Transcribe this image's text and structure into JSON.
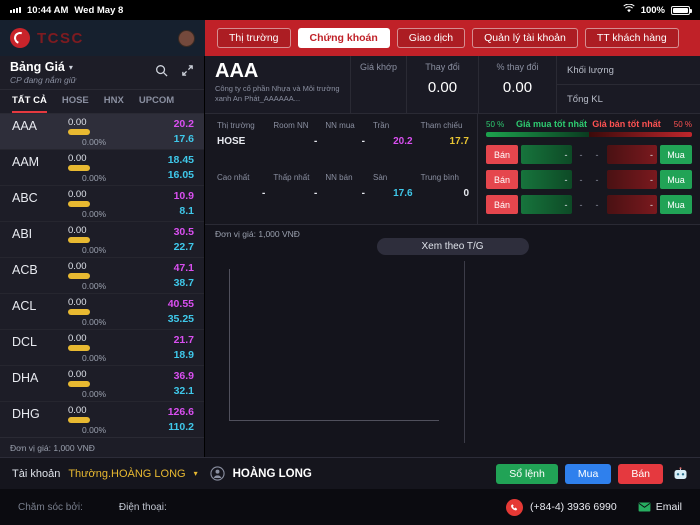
{
  "status_bar": {
    "time": "10:44 AM",
    "date": "Wed May 8",
    "battery": "100%"
  },
  "header": {
    "brand": "TCSC",
    "tabs": [
      {
        "label": "Thị trường"
      },
      {
        "label": "Chứng khoán"
      },
      {
        "label": "Giao dịch"
      },
      {
        "label": "Quản lý tài khoản"
      },
      {
        "label": "TT khách hàng"
      }
    ]
  },
  "sidebar": {
    "title": "Bảng Giá",
    "subtitle": "CP đang nắm giữ",
    "tabs": [
      "TẤT CẢ",
      "HOSE",
      "HNX",
      "UPCOM"
    ],
    "unit_note": "Đơn vị giá: 1,000 VNĐ",
    "stocks": [
      {
        "symbol": "AAA",
        "value": "0.00",
        "percent": "0.00%",
        "top": "20.2",
        "bottom": "17.6",
        "top_color": "#d94ff0",
        "bottom_color": "#3fc8ea"
      },
      {
        "symbol": "AAM",
        "value": "0.00",
        "percent": "0.00%",
        "top": "18.45",
        "bottom": "16.05",
        "top_color": "#3fc8ea",
        "bottom_color": "#3fc8ea"
      },
      {
        "symbol": "ABC",
        "value": "0.00",
        "percent": "0.00%",
        "top": "10.9",
        "bottom": "8.1",
        "top_color": "#d94ff0",
        "bottom_color": "#3fc8ea"
      },
      {
        "symbol": "ABI",
        "value": "0.00",
        "percent": "0.00%",
        "top": "30.5",
        "bottom": "22.7",
        "top_color": "#d94ff0",
        "bottom_color": "#3fc8ea"
      },
      {
        "symbol": "ACB",
        "value": "0.00",
        "percent": "0.00%",
        "top": "47.1",
        "bottom": "38.7",
        "top_color": "#d94ff0",
        "bottom_color": "#3fc8ea"
      },
      {
        "symbol": "ACL",
        "value": "0.00",
        "percent": "0.00%",
        "top": "40.55",
        "bottom": "35.25",
        "top_color": "#d94ff0",
        "bottom_color": "#3fc8ea"
      },
      {
        "symbol": "DCL",
        "value": "0.00",
        "percent": "0.00%",
        "top": "21.7",
        "bottom": "18.9",
        "top_color": "#d94ff0",
        "bottom_color": "#3fc8ea"
      },
      {
        "symbol": "DHA",
        "value": "0.00",
        "percent": "0.00%",
        "top": "36.9",
        "bottom": "32.1",
        "top_color": "#d94ff0",
        "bottom_color": "#3fc8ea"
      },
      {
        "symbol": "DHG",
        "value": "0.00",
        "percent": "0.00%",
        "top": "126.6",
        "bottom": "110.2",
        "top_color": "#d94ff0",
        "bottom_color": "#3fc8ea"
      }
    ]
  },
  "main": {
    "symbol": "AAA",
    "company": "Công ty cổ phần Nhựa và Môi trường xanh An Phát_AAAAAA...",
    "quote": {
      "matched_label": "Giá khớp",
      "change_label": "Thay đổi",
      "change_value": "0.00",
      "pct_change_label": "% thay đổi",
      "pct_change_value": "0.00",
      "volume_label": "Khối lượng",
      "total_volume_label": "Tổng KL"
    },
    "info": {
      "market_label": "Thị trường",
      "market": "HOSE",
      "room_nn_label": "Room NN",
      "room_nn": "-",
      "nn_buy_label": "NN mua",
      "nn_buy": "-",
      "ceiling_label": "Trần",
      "ceiling": "20.2",
      "reference_label": "Tham chiếu",
      "reference": "17.7",
      "highest_label": "Cao nhất",
      "highest": "-",
      "lowest_label": "Thấp nhất",
      "lowest": "-",
      "nn_sell_label": "NN bán",
      "nn_sell": "-",
      "floor_label": "Sàn",
      "floor": "17.6",
      "average_label": "Trung bình",
      "average": "0"
    },
    "orderbook": {
      "buy_pct": "50 %",
      "sell_pct": "50 %",
      "buy_title": "Giá mua tốt nhất",
      "sell_title": "Giá bán tốt nhất",
      "sell_button": "Bán",
      "buy_button": "Mua",
      "rows": [
        {
          "buy_vol": "-",
          "buy_price": "-",
          "sell_price": "-",
          "sell_vol": "-"
        },
        {
          "buy_vol": "-",
          "buy_price": "-",
          "sell_price": "-",
          "sell_vol": "-"
        },
        {
          "buy_vol": "-",
          "buy_price": "-",
          "sell_price": "-",
          "sell_vol": "-"
        }
      ]
    },
    "unit_note": "Đơn vị giá: 1,000 VNĐ",
    "view_toggle": "Xem theo T/G"
  },
  "account_bar": {
    "label": "Tài khoản",
    "account_type": "Thường.HOÀNG LONG",
    "user_name": "HOÀNG LONG",
    "order_book_button": "Sổ lệnh",
    "buy_button": "Mua",
    "sell_button": "Bán"
  },
  "footer": {
    "care_label": "Chăm sóc bởi:",
    "phone_label": "Điện thoại:",
    "phone_number": "(+84-4) 3936 6990",
    "email_label": "Email"
  },
  "colors": {
    "brand_red": "#c02128",
    "ceiling_purple": "#d94ff0",
    "floor_cyan": "#3fc8ea",
    "reference_yellow": "#e9c533",
    "holding_yellow": "#e8b931",
    "buy_green": "#21a356",
    "sell_red": "#e5393f",
    "order_blue": "#2f80ed"
  }
}
